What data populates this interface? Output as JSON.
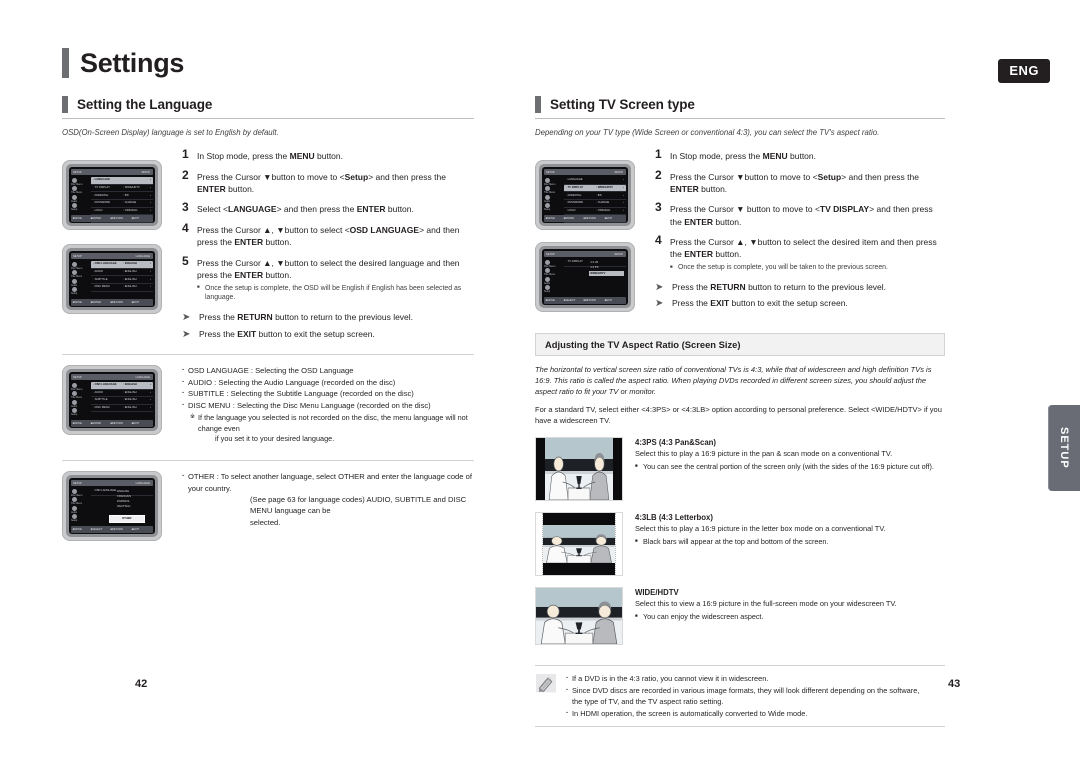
{
  "header": {
    "chapter_title": "Settings",
    "language_badge": "ENG"
  },
  "side_tab": {
    "label": "SETUP"
  },
  "page_numbers": {
    "left": "42",
    "right": "43"
  },
  "left_column": {
    "section_title": "Setting the Language",
    "intro": "OSD(On-Screen Display) language is set to English by default.",
    "steps": [
      {
        "num": "1",
        "parts": [
          {
            "t": "In Stop mode, press the ",
            "b": false
          },
          {
            "t": "MENU",
            "b": true
          },
          {
            "t": " button.",
            "b": false
          }
        ]
      },
      {
        "num": "2",
        "parts": [
          {
            "t": "Press the Cursor ▼button to move to  <",
            "b": false
          },
          {
            "t": "Setup",
            "b": true
          },
          {
            "t": "> and then press the ",
            "b": false
          },
          {
            "t": "ENTER",
            "b": true
          },
          {
            "t": " button.",
            "b": false
          }
        ]
      },
      {
        "num": "3",
        "parts": [
          {
            "t": "Select <",
            "b": false
          },
          {
            "t": "LANGUAGE",
            "b": true
          },
          {
            "t": "> and then press the ",
            "b": false
          },
          {
            "t": "ENTER",
            "b": true
          },
          {
            "t": " button.",
            "b": false
          }
        ]
      },
      {
        "num": "4",
        "parts": [
          {
            "t": "Press the Cursor ▲, ▼button to select  <",
            "b": false
          },
          {
            "t": "OSD LANGUAGE",
            "b": true
          },
          {
            "t": "> and then press the ",
            "b": false
          },
          {
            "t": "ENTER",
            "b": true
          },
          {
            "t": " button.",
            "b": false
          }
        ]
      },
      {
        "num": "5",
        "parts": [
          {
            "t": "Press the Cursor ▲, ▼button to select the desired language and then press the ",
            "b": false
          },
          {
            "t": "ENTER",
            "b": true
          },
          {
            "t": " button.",
            "b": false
          }
        ]
      }
    ],
    "step5_subnote": "Once the setup is complete, the OSD will be English if English has been selected as language.",
    "arrow_notes": [
      {
        "parts": [
          {
            "t": "Press the ",
            "b": false
          },
          {
            "t": "RETURN",
            "b": true
          },
          {
            "t": " button to return to the previous level.",
            "b": false
          }
        ]
      },
      {
        "parts": [
          {
            "t": "Press the ",
            "b": false
          },
          {
            "t": "EXIT",
            "b": true
          },
          {
            "t": " button to exit the setup screen.",
            "b": false
          }
        ]
      }
    ],
    "language_bullets": [
      "OSD LANGUAGE : Selecting the OSD Language",
      "AUDIO : Selecting the Audio Language (recorded on the disc)",
      "SUBTITLE : Selecting the Subtitle Language (recorded on the disc)",
      "DISC MENU : Selecting the Disc Menu Language (recorded on the disc)"
    ],
    "language_subnote_line1": "If the language you selected is not recorded on the disc, the menu language will not change even",
    "language_subnote_line2": "if you set it to your desired language.",
    "other_line1": "OTHER : To select another language, select OTHER and enter the language code of your country.",
    "other_line2": "(See page 63 for language codes) AUDIO, SUBTITLE and DISC MENU language can be",
    "other_line3": "selected.",
    "osd_screens": [
      {
        "name": "setup-menu",
        "top_left": "SETUP",
        "top_right": "SETUP",
        "left_icons": [
          "Disc Menu",
          "Title Menu",
          "Audio",
          "Setup"
        ],
        "rows": [
          {
            "name": "LANGUAGE",
            "value": "",
            "highlight": true
          },
          {
            "name": "TV DISPLAY",
            "value": "WIDE/HDTV",
            "highlight": false
          },
          {
            "name": "PARENTAL",
            "value": "8/8",
            "highlight": false
          },
          {
            "name": "PASSWORD",
            "value": "CHANGE",
            "highlight": false
          },
          {
            "name": "LOGO",
            "value": "ORIGINAL",
            "highlight": false
          },
          {
            "name": "DVD TYPE",
            "value": "DVD AUDIO",
            "highlight": false
          }
        ],
        "bottom": [
          "MOVE",
          "ENTER",
          "RETURN",
          "EXIT"
        ]
      },
      {
        "name": "language-menu",
        "top_left": "SETUP",
        "top_right": "LANGUAGE",
        "left_icons": [
          "Disc Menu",
          "Title Menu",
          "Audio",
          "Setup"
        ],
        "rows": [
          {
            "name": "OSD LANGUAGE",
            "value": "ENGLISH",
            "highlight": true
          },
          {
            "name": "AUDIO",
            "value": "ENGLISH",
            "highlight": false
          },
          {
            "name": "SUBTITLE",
            "value": "ENGLISH",
            "highlight": false
          },
          {
            "name": "DISC MENU",
            "value": "ENGLISH",
            "highlight": false
          }
        ],
        "bottom": [
          "MOVE",
          "ENTER",
          "RETURN",
          "EXIT"
        ]
      },
      {
        "name": "language-menu-2",
        "top_left": "SETUP",
        "top_right": "LANGUAGE",
        "left_icons": [
          "Disc Menu",
          "Title Menu",
          "Audio",
          "Setup"
        ],
        "rows": [
          {
            "name": "OSD LANGUAGE",
            "value": "ENGLISH",
            "highlight": true
          },
          {
            "name": "AUDIO",
            "value": "ENGLISH",
            "highlight": false
          },
          {
            "name": "SUBTITLE",
            "value": "ENGLISH",
            "highlight": false
          },
          {
            "name": "DISC MENU",
            "value": "ENGLISH",
            "highlight": false
          }
        ],
        "bottom": [
          "MOVE",
          "ENTER",
          "RETURN",
          "EXIT"
        ]
      },
      {
        "name": "osd-language-options",
        "top_left": "SETUP",
        "top_right": "LANGUAGE",
        "left_icons": [
          "Disc Menu",
          "Title Menu",
          "Audio",
          "Setup"
        ],
        "label": "OSD LANGUAGE",
        "options": [
          "ENGLISH",
          "FRANCAIS",
          "ESPANOL",
          "DEUTSCH"
        ],
        "popup": "OTHER",
        "bottom": [
          "MOVE",
          "SELECT",
          "RETURN",
          "EXIT"
        ]
      }
    ]
  },
  "right_column": {
    "section_title": "Setting TV Screen type",
    "intro": "Depending on your TV type (Wide Screen  or conventional 4:3), you can select the TV's aspect ratio.",
    "steps": [
      {
        "num": "1",
        "parts": [
          {
            "t": "In Stop mode, press the ",
            "b": false
          },
          {
            "t": "MENU",
            "b": true
          },
          {
            "t": " button.",
            "b": false
          }
        ]
      },
      {
        "num": "2",
        "parts": [
          {
            "t": "Press the Cursor ▼button to move to  <",
            "b": false
          },
          {
            "t": "Setup",
            "b": true
          },
          {
            "t": "> and then press the ",
            "b": false
          },
          {
            "t": "ENTER",
            "b": true
          },
          {
            "t": " button.",
            "b": false
          }
        ]
      },
      {
        "num": "3",
        "parts": [
          {
            "t": "Press the Cursor ▼ button to move to  <",
            "b": false
          },
          {
            "t": "TV DISPLAY",
            "b": true
          },
          {
            "t": "> and then press the ",
            "b": false
          },
          {
            "t": "ENTER",
            "b": true
          },
          {
            "t": " button.",
            "b": false
          }
        ]
      },
      {
        "num": "4",
        "parts": [
          {
            "t": "Press the Cursor ▲, ▼button to select the desired item and then press the ",
            "b": false
          },
          {
            "t": "ENTER",
            "b": true
          },
          {
            "t": " button.",
            "b": false
          }
        ]
      }
    ],
    "step4_subnote": "Once the setup is complete, you will be taken to the previous screen.",
    "arrow_notes": [
      {
        "parts": [
          {
            "t": "Press the ",
            "b": false
          },
          {
            "t": "RETURN",
            "b": true
          },
          {
            "t": " button to return to the previous level.",
            "b": false
          }
        ]
      },
      {
        "parts": [
          {
            "t": "Press the ",
            "b": false
          },
          {
            "t": "EXIT",
            "b": true
          },
          {
            "t": " button to exit the setup screen.",
            "b": false
          }
        ]
      }
    ],
    "subsection_title": "Adjusting the TV Aspect Ratio (Screen Size)",
    "aspect_intro_line1": "The horizontal to vertical screen size ratio of conventional TVs is 4:3, while that of widescreen and high definition TVs is 16:9. This ratio is",
    "aspect_intro_line2": "called the aspect ratio. When playing DVDs recorded in different screen sizes, you should adjust the aspect ratio to fit your TV or monitor.",
    "aspect_para_line1": "For a standard TV, select either <4:3PS> or <4:3LB> option according to personal preference. Select <WIDE/HDTV> if you have a",
    "aspect_para_line2": "widescreen TV.",
    "aspect_items": [
      {
        "key": "pan-scan",
        "title": "4:3PS (4:3 Pan&Scan)",
        "desc": "Select this to play a 16:9 picture in the pan & scan mode on a conventional TV.",
        "bullet": "You can see the central portion of the screen only (with the sides of the 16:9 picture cut off)."
      },
      {
        "key": "letterbox",
        "title": "4:3LB (4:3 Letterbox)",
        "desc": "Select this to play a 16:9 picture in the letter box mode on a conventional TV.",
        "bullet": "Black bars will appear at the top and bottom of the screen."
      },
      {
        "key": "wide-hdtv",
        "title": "WIDE/HDTV",
        "desc": "Select this to view a 16:9 picture in the full-screen mode on your widescreen TV.",
        "bullet": "You can enjoy the widescreen aspect."
      }
    ],
    "note_lines": [
      "If a DVD is in the 4:3 ratio, you cannot view it in widescreen.",
      "Since DVD discs are recorded in various image formats, they will look different depending on the software,",
      "the type of TV, and the TV aspect ratio setting.",
      "In HDMI operation, the screen is automatically converted to Wide mode."
    ],
    "osd_screens": [
      {
        "name": "setup-menu",
        "top_left": "SETUP",
        "top_right": "SETUP",
        "left_icons": [
          "Disc Menu",
          "Title Menu",
          "Audio",
          "Setup"
        ],
        "rows": [
          {
            "name": "LANGUAGE",
            "value": "",
            "highlight": false
          },
          {
            "name": "TV DISPLAY",
            "value": "WIDE/HDTV",
            "highlight": true
          },
          {
            "name": "PARENTAL",
            "value": "8/8",
            "highlight": false
          },
          {
            "name": "PASSWORD",
            "value": "CHANGE",
            "highlight": false
          },
          {
            "name": "LOGO",
            "value": "ORIGINAL",
            "highlight": false
          },
          {
            "name": "DVD TYPE",
            "value": "DVD AUDIO",
            "highlight": false
          }
        ],
        "bottom": [
          "MOVE",
          "ENTER",
          "RETURN",
          "EXIT"
        ]
      },
      {
        "name": "tv-display-options",
        "top_left": "SETUP",
        "top_right": "SETUP",
        "left_icons": [
          "Disc Menu",
          "Title Menu",
          "Audio",
          "Setup"
        ],
        "label": "TV DISPLAY",
        "options": [
          "4:3 LB",
          "4:3 PS",
          "WIDE/HDTV"
        ],
        "highlight_index": 2,
        "bottom": [
          "MOVE",
          "SELECT",
          "RETURN",
          "EXIT"
        ]
      }
    ]
  },
  "icons": {
    "arrow": "➤",
    "note": "pencil-icon"
  }
}
